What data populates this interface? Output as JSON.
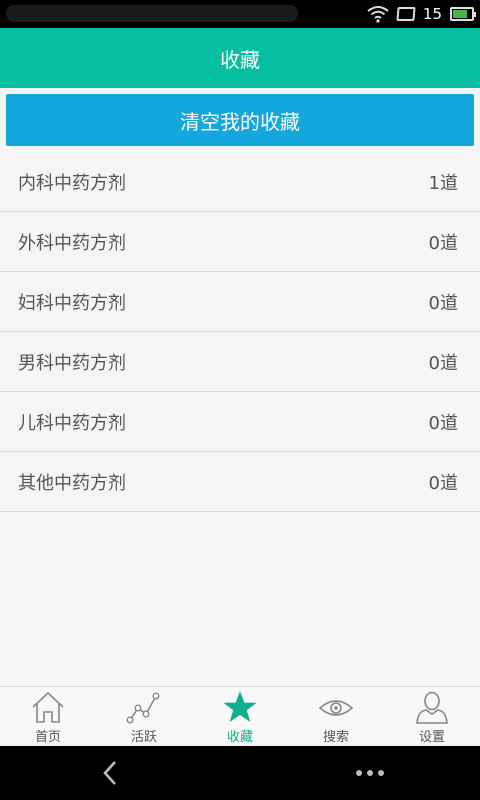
{
  "status_bar": {
    "battery_level": "15"
  },
  "header": {
    "title": "收藏"
  },
  "clear_button": {
    "label": "清空我的收藏"
  },
  "categories": [
    {
      "name": "内科中药方剂",
      "count": "1道"
    },
    {
      "name": "外科中药方剂",
      "count": "0道"
    },
    {
      "name": "妇科中药方剂",
      "count": "0道"
    },
    {
      "name": "男科中药方剂",
      "count": "0道"
    },
    {
      "name": "儿科中药方剂",
      "count": "0道"
    },
    {
      "name": "其他中药方剂",
      "count": "0道"
    }
  ],
  "tabs": [
    {
      "label": "首页",
      "icon": "home-icon"
    },
    {
      "label": "活跃",
      "icon": "activity-icon"
    },
    {
      "label": "收藏",
      "icon": "star-icon",
      "active": true
    },
    {
      "label": "搜索",
      "icon": "eye-icon"
    },
    {
      "label": "设置",
      "icon": "user-icon"
    }
  ],
  "colors": {
    "header": "#06bfa0",
    "button": "#14a7de",
    "active_tab": "#0fae8f"
  }
}
